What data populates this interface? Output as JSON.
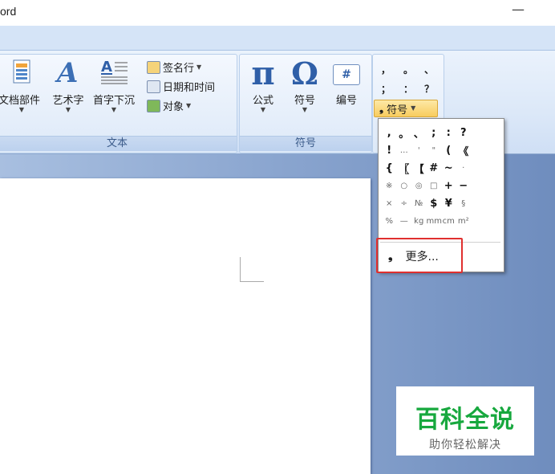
{
  "window": {
    "title": "ord",
    "minimize_glyph": "—"
  },
  "ribbon": {
    "text_group": {
      "label": "文本",
      "buttons": [
        {
          "label": "文档部件",
          "icon": "quickparts-icon"
        },
        {
          "label": "艺术字",
          "icon": "wordart-icon"
        },
        {
          "label": "首字下沉",
          "icon": "dropcap-icon"
        }
      ],
      "small_buttons": [
        {
          "label": "签名行",
          "icon": "signature-line-icon"
        },
        {
          "label": "日期和时间",
          "icon": "date-time-icon"
        },
        {
          "label": "对象",
          "icon": "object-icon"
        }
      ]
    },
    "symbols_group": {
      "label": "符号",
      "buttons": [
        {
          "label": "公式",
          "icon": "equation-pi-icon",
          "glyph": "π"
        },
        {
          "label": "符号",
          "icon": "symbol-omega-icon",
          "glyph": "Ω"
        },
        {
          "label": "编号",
          "icon": "number-icon",
          "glyph": "#"
        }
      ]
    },
    "punctuation_palette": {
      "rows": [
        [
          "，",
          "。",
          "、"
        ],
        [
          "；",
          "：",
          "？"
        ]
      ],
      "button_label": "符号"
    }
  },
  "symbol_dropdown": {
    "grid": [
      [
        ",",
        "。",
        "、",
        ";",
        ":",
        "?"
      ],
      [
        "!",
        "…",
        "'",
        "\"",
        "(",
        "《"
      ],
      [
        "{",
        "〖",
        "【",
        "#",
        "~",
        "·"
      ],
      [
        "※",
        "○",
        "◎",
        "□",
        "+",
        "−"
      ],
      [
        "×",
        "÷",
        "№",
        "$",
        "¥",
        "§"
      ],
      [
        "%",
        "—",
        "kg",
        "mm",
        "cm",
        "m²"
      ]
    ],
    "more_label": "更多..."
  },
  "watermark": {
    "title": "百科全说",
    "subtitle": "助你轻松解决"
  },
  "colors": {
    "accent_highlight": "#e0302f",
    "watermark_green": "#17a83e",
    "ribbon_blue": "#dce8f8"
  }
}
